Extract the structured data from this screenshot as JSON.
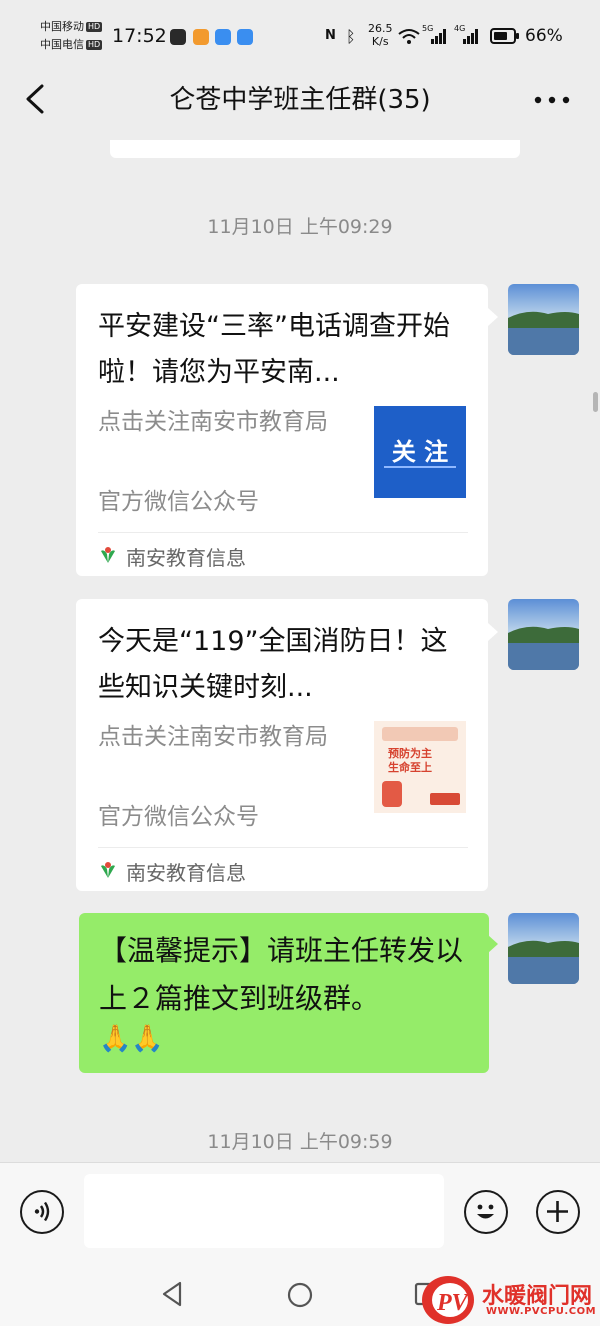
{
  "status_bar": {
    "carrier1": "中国移动",
    "carrier2": "中国电信",
    "hd": "HD",
    "time": "17:52",
    "speed_value": "26.5",
    "speed_unit": "K/s",
    "net1": "5G",
    "net2": "4G",
    "battery": "66%"
  },
  "header": {
    "title": "仑苍中学班主任群(35)"
  },
  "messages": {
    "timestamp1": "11月10日 上午09:29",
    "card1": {
      "title": "平安建设“三率”电话调查开始啦！请您为平安南...",
      "desc1": "点击关注南安市教育局",
      "desc2": "官方微信公众号",
      "thumb_text": "关 注",
      "source": "南安教育信息"
    },
    "card2": {
      "title": "今天是“119”全国消防日！这些知识关键时刻...",
      "desc1": "点击关注南安市教育局",
      "desc2": "官方微信公众号",
      "thumb_text": "预防为主 生命至上",
      "source": "南安教育信息"
    },
    "text1": "【温馨提示】请班主任转发以上２篇推文到班级群。",
    "text1_emoji": "🙏🙏",
    "timestamp2": "11月10日 上午09:59"
  },
  "watermark": {
    "brand": "水暖阀门网",
    "url": "WWW.PVCPU.COM",
    "mark": "PV"
  },
  "colors": {
    "bubble_green": "#95ec69",
    "background": "#ededed",
    "thumb_blue": "#1e5fc8"
  }
}
